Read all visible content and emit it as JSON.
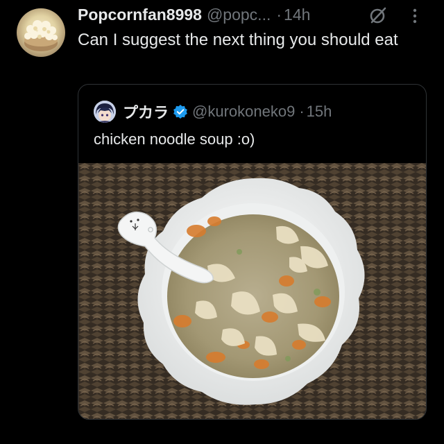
{
  "tweet": {
    "author": {
      "display_name": "Popcornfan8998",
      "handle": "@popc...",
      "avatar_icon": "popcorn-bowl-avatar"
    },
    "separator": "·",
    "timestamp": "14h",
    "edited_icon": "edited-icon",
    "more_icon": "more-vertical-icon",
    "text": "Can I suggest the next thing you should eat"
  },
  "quote": {
    "author": {
      "display_name": "プカラ",
      "handle": "@kurokoneko9",
      "verified": true,
      "avatar_icon": "anime-character-avatar"
    },
    "separator": "·",
    "timestamp": "15h",
    "text": "chicken noodle soup :o)",
    "media": {
      "icon": "soup-bowl-photo"
    }
  },
  "colors": {
    "background": "#000000",
    "text_primary": "#e7e9ea",
    "text_secondary": "#71767b",
    "border": "#2f3336",
    "verified_blue": "#1d9bf0"
  }
}
